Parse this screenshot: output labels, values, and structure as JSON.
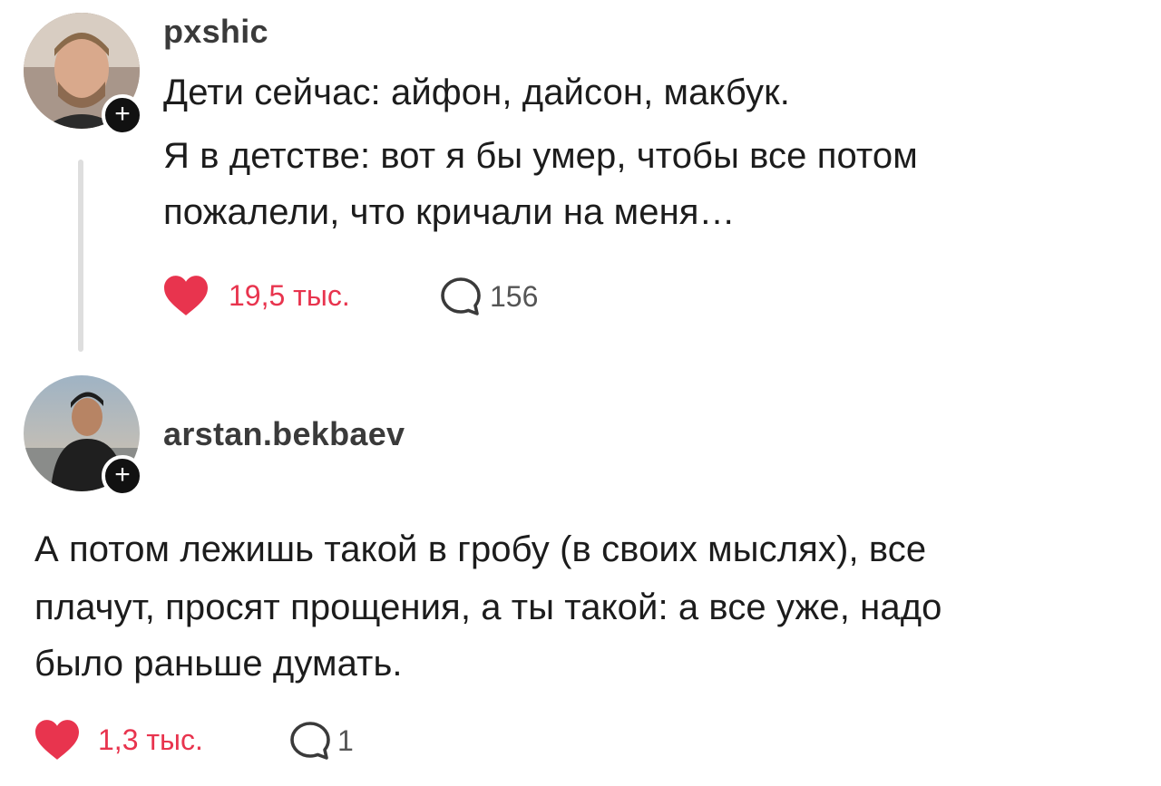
{
  "posts": [
    {
      "username": "pxshic",
      "follow_symbol": "+",
      "lines": [
        "Дети сейчас: айфон, дайсон, макбук.",
        "Я в детстве: вот я бы умер, чтобы все потом",
        "пожалели, что кричали на меня…"
      ],
      "likes": "19,5 тыс.",
      "replies": "156",
      "liked": true,
      "like_color": "#e8344e"
    },
    {
      "username": "arstan.bekbaev",
      "follow_symbol": "+",
      "lines": [
        "А потом лежишь такой в гробу (в своих мыслях), все",
        "плачут, просят прощения, а ты такой: а все уже, надо",
        "было раньше думать."
      ],
      "likes": "1,3 тыс.",
      "replies": "1",
      "liked": true,
      "like_color": "#e8344e"
    }
  ],
  "icons": {
    "like": "heart-icon",
    "reply": "comment-bubble-icon",
    "follow": "plus-icon"
  }
}
